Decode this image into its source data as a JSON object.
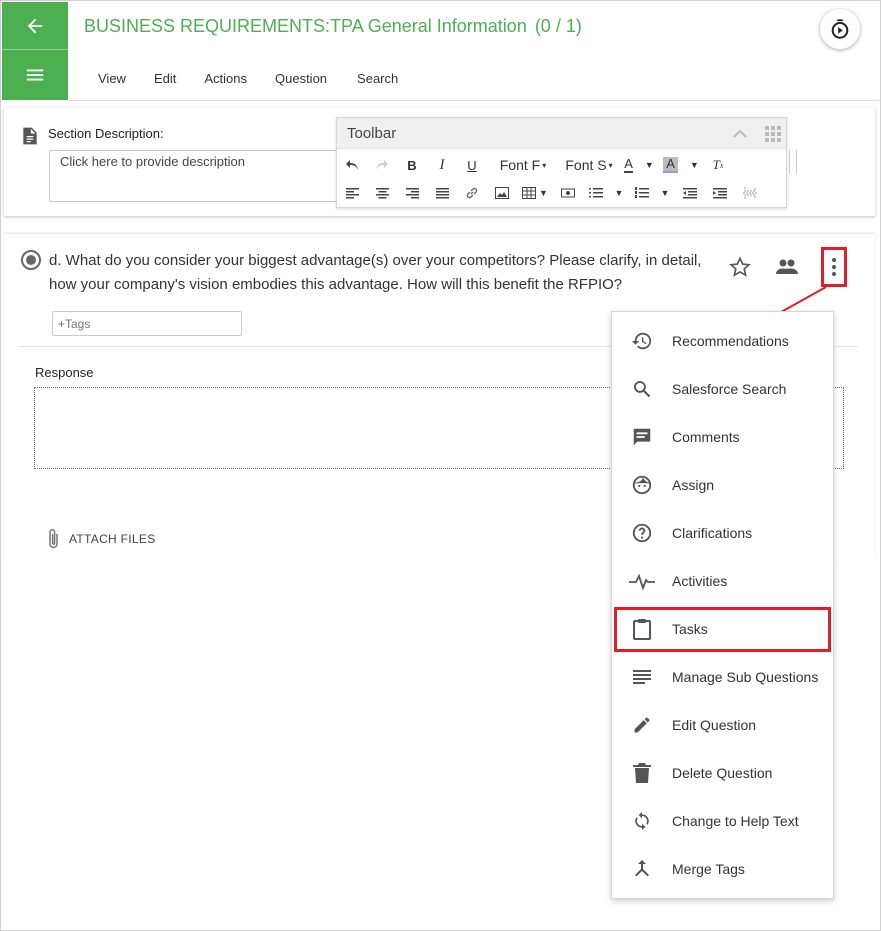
{
  "header": {
    "title": "BUSINESS REQUIREMENTS:TPA General Information",
    "count": "(0 / 1)",
    "menu": [
      "View",
      "Edit",
      "Actions",
      "Question",
      "Search"
    ],
    "accent_color": "#4caf50"
  },
  "section": {
    "label": "Section Description:",
    "placeholder": "Click here to provide description"
  },
  "toolbar": {
    "title": "Toolbar",
    "font_family": "Font F",
    "font_size": "Font S",
    "bold": "B",
    "italic": "I",
    "underline": "U"
  },
  "question": {
    "text": "d. What do you consider your biggest advantage(s) over your competitors? Please clarify, in detail, how your company's vision embodies this advantage. How will this benefit the RFPIO?",
    "tags_placeholder": "+Tags",
    "response_label": "Response",
    "attach_label": "ATTACH FILES"
  },
  "dropdown": {
    "items": [
      {
        "label": "Recommendations",
        "icon": "history-icon"
      },
      {
        "label": "Salesforce Search",
        "icon": "search-icon"
      },
      {
        "label": "Comments",
        "icon": "comment-icon"
      },
      {
        "label": "Assign",
        "icon": "face-icon"
      },
      {
        "label": "Clarifications",
        "icon": "help-icon"
      },
      {
        "label": "Activities",
        "icon": "pulse-icon"
      },
      {
        "label": "Tasks",
        "icon": "clipboard-icon"
      },
      {
        "label": "Manage Sub Questions",
        "icon": "lines-icon"
      },
      {
        "label": "Edit Question",
        "icon": "pencil-icon"
      },
      {
        "label": "Delete Question",
        "icon": "trash-icon"
      },
      {
        "label": "Change to Help Text",
        "icon": "sync-icon"
      },
      {
        "label": "Merge Tags",
        "icon": "merge-icon"
      }
    ],
    "highlighted": "Tasks",
    "highlight_color": "#e11d2a"
  }
}
